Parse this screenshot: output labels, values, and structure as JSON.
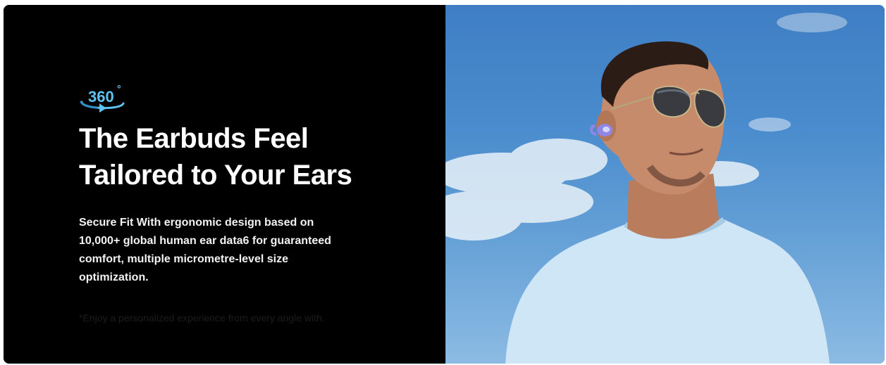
{
  "banner": {
    "headline_line1": "The Earbuds Feel",
    "headline_line2": "Tailored to Your Ears",
    "body_line1": "Secure Fit With ergonomic design based on",
    "body_line2": "10,000+ global human ear data6 for guaranteed",
    "body_line3": "comfort, multiple micrometre-level size",
    "body_line4": "optimization.",
    "footnote": "*Enjoy a personalized experience from every angle with."
  },
  "icon": {
    "name": "360-degree-icon",
    "number": "360",
    "degree_symbol": "°",
    "color": "#5bc4f0"
  },
  "photo": {
    "subject": "man-wearing-earbuds-photo",
    "sky_color": "#4a8ccd",
    "shirt_color": "#cfe6f6"
  }
}
